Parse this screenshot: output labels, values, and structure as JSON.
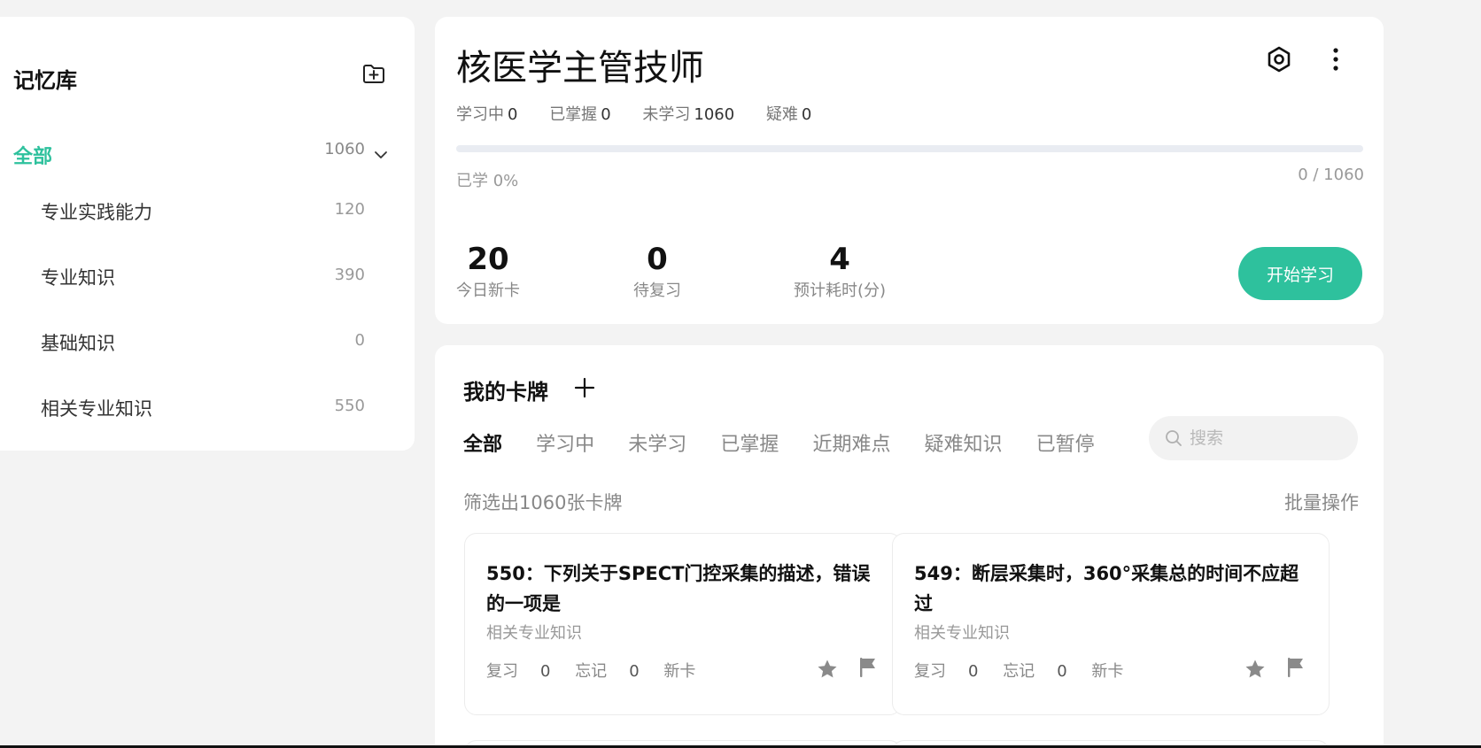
{
  "sidebar": {
    "title": "记忆库",
    "all_label": "全部",
    "all_count": "1060",
    "items": [
      {
        "label": "专业实践能力",
        "count": "120"
      },
      {
        "label": "专业知识",
        "count": "390"
      },
      {
        "label": "基础知识",
        "count": "0"
      },
      {
        "label": "相关专业知识",
        "count": "550"
      }
    ]
  },
  "deck": {
    "title": "核医学主管技师",
    "stats": [
      {
        "label": "学习中",
        "value": "0"
      },
      {
        "label": "已掌握",
        "value": "0"
      },
      {
        "label": "未学习",
        "value": "1060"
      },
      {
        "label": "疑难",
        "value": "0"
      }
    ],
    "progress_fraction": 0,
    "learned_text": "已学 0%",
    "ratio_text": "0 / 1060",
    "metrics": [
      {
        "num": "20",
        "label": "今日新卡"
      },
      {
        "num": "0",
        "label": "待复习"
      },
      {
        "num": "4",
        "label": "预计耗时(分)"
      }
    ],
    "start_label": "开始学习",
    "accent_color": "#2ec19d"
  },
  "cards_panel": {
    "title": "我的卡牌",
    "tabs": [
      "全部",
      "学习中",
      "未学习",
      "已掌握",
      "近期难点",
      "疑难知识",
      "已暂停"
    ],
    "active_tab": "全部",
    "search_placeholder": "搜索",
    "filter_text": "筛选出1060张卡牌",
    "batch_label": "批量操作",
    "cards": [
      {
        "title": "550：下列关于SPECT门控采集的描述，错误的一项是",
        "category": "相关专业知识",
        "review_label": "复习",
        "review": "0",
        "forget_label": "忘记",
        "forget": "0",
        "status": "新卡"
      },
      {
        "title": "549：断层采集时，360°采集总的时间不应超过",
        "category": "相关专业知识",
        "review_label": "复习",
        "review": "0",
        "forget_label": "忘记",
        "forget": "0",
        "status": "新卡"
      }
    ]
  },
  "icons": {
    "sidebar_add": "folder-plus-icon",
    "chevron": "chevron-down-icon",
    "settings": "settings-hex-icon",
    "more": "more-vertical-icon",
    "add": "plus-icon",
    "search": "search-icon",
    "star": "star-icon",
    "flag": "flag-icon"
  }
}
